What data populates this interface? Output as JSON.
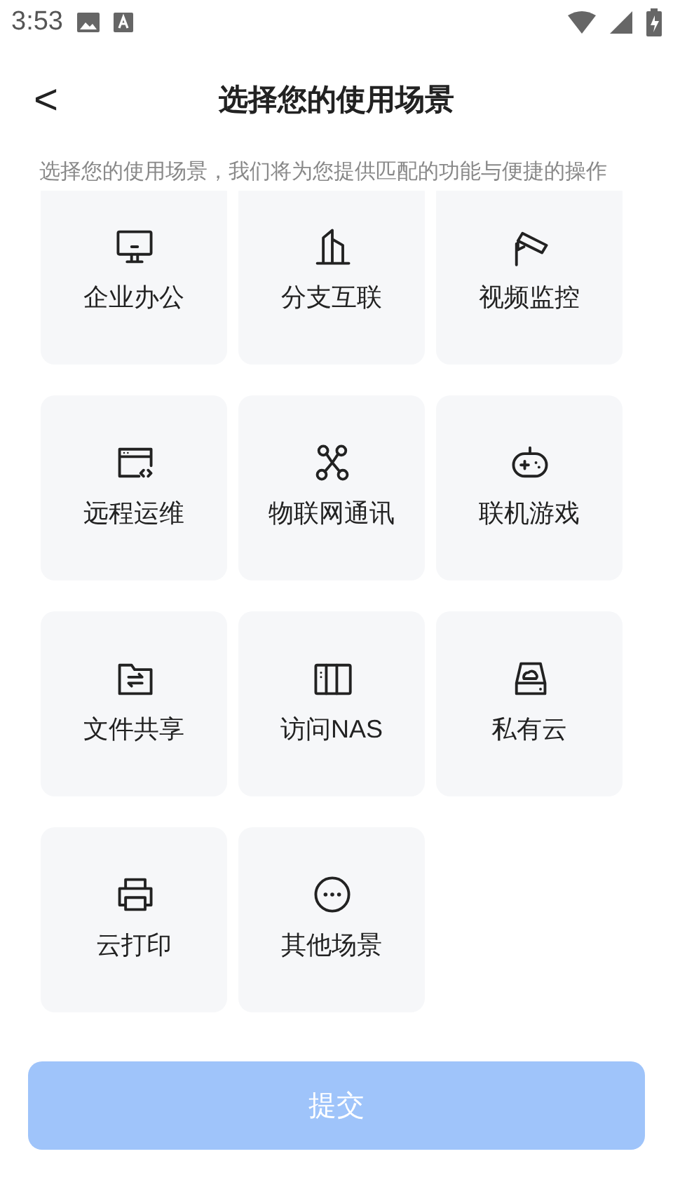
{
  "status_bar": {
    "time": "3:53"
  },
  "header": {
    "back": "<",
    "title": "选择您的使用场景"
  },
  "subtitle": "选择您的使用场景，我们将为您提供匹配的功能与便捷的操作",
  "scenes": [
    {
      "label": "企业办公"
    },
    {
      "label": "分支互联"
    },
    {
      "label": "视频监控"
    },
    {
      "label": "远程运维"
    },
    {
      "label": "物联网通讯"
    },
    {
      "label": "联机游戏"
    },
    {
      "label": "文件共享"
    },
    {
      "label": "访问NAS"
    },
    {
      "label": "私有云"
    },
    {
      "label": "云打印"
    },
    {
      "label": "其他场景"
    }
  ],
  "submit_button": {
    "label": "提交",
    "disabled": true
  }
}
